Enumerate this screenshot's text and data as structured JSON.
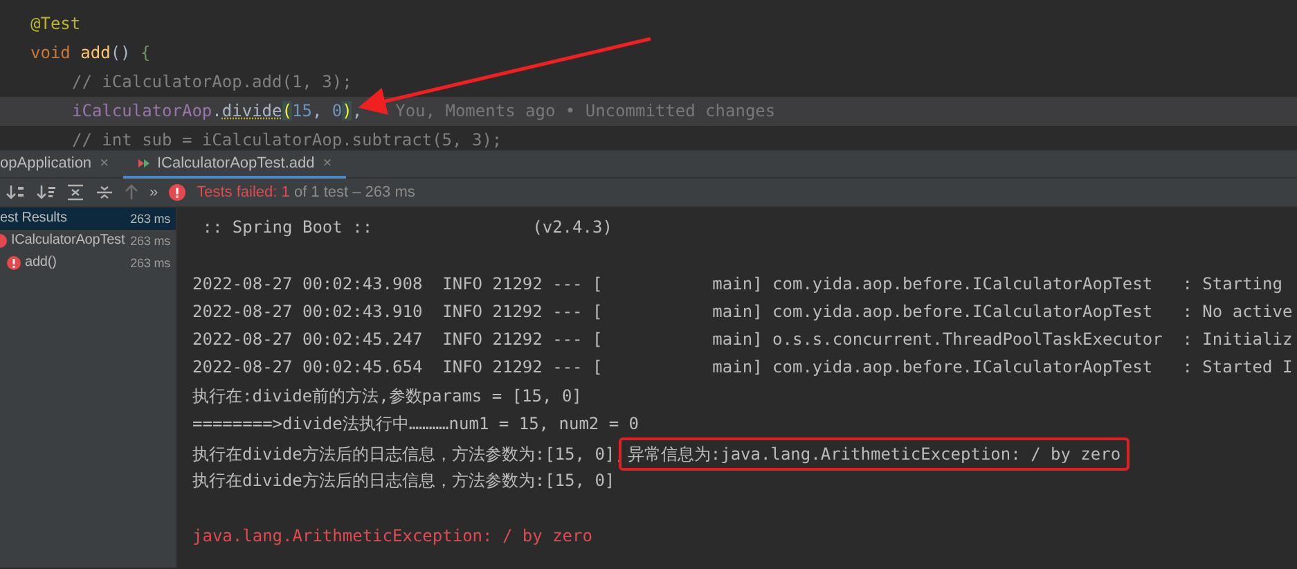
{
  "editor": {
    "lines": [
      {
        "indented": false,
        "current": false,
        "segments": [
          {
            "text": "@Test",
            "kind": "annotation"
          }
        ]
      },
      {
        "indented": false,
        "current": false,
        "segments": [
          {
            "text": "void ",
            "kind": "keyword"
          },
          {
            "text": "add",
            "kind": "method"
          },
          {
            "text": "() ",
            "kind": "plain"
          },
          {
            "text": "{",
            "kind": "brace"
          }
        ]
      },
      {
        "indented": true,
        "current": false,
        "segments": [
          {
            "text": "// iCalculatorAop.add(1, 3);",
            "kind": "comment"
          }
        ]
      },
      {
        "indented": true,
        "current": true,
        "segments": [
          {
            "text": "iCalculatorAop",
            "kind": "field"
          },
          {
            "text": ".",
            "kind": "plain"
          },
          {
            "text": "divide",
            "kind": "call"
          },
          {
            "text": "(",
            "kind": "matched"
          },
          {
            "text": "15",
            "kind": "number"
          },
          {
            "text": ", ",
            "kind": "plain"
          },
          {
            "text": "0",
            "kind": "number"
          },
          {
            "text": ")",
            "kind": "matched"
          },
          {
            "text": ",",
            "kind": "plain"
          },
          {
            "text": "You, Moments ago • Uncommitted changes",
            "kind": "hint"
          }
        ]
      },
      {
        "indented": true,
        "current": false,
        "segments": [
          {
            "text": "// int sub = iCalculatorAop.subtract(5, 3);",
            "kind": "comment"
          }
        ]
      }
    ]
  },
  "tabs": [
    {
      "label": "opApplication",
      "close": "×",
      "selected": false
    },
    {
      "label": "ICalculatorAopTest.add",
      "close": "×",
      "selected": true
    }
  ],
  "toolbar": {
    "more": "»",
    "failed": "Tests failed: 1",
    "summary": " of 1 test – 263 ms"
  },
  "tree": [
    {
      "label": "est Results",
      "time": "263 ms",
      "selected": true,
      "failed": false,
      "children": [
        {
          "label": "ICalculatorAopTest",
          "time": "263 ms",
          "selected": false,
          "failed": true,
          "children": [
            {
              "label": "add()",
              "time": "263 ms",
              "selected": false,
              "failed": true
            }
          ]
        }
      ]
    }
  ],
  "console": [
    {
      "kind": "plain",
      "segments": [
        {
          "text": " :: Spring Boot ::                (v2.4.3)",
          "boxed": false
        }
      ]
    },
    {
      "kind": "blank"
    },
    {
      "kind": "plain",
      "segments": [
        {
          "text": "2022-08-27 00:02:43.908  INFO 21292 --- [           main] com.yida.aop.before.ICalculatorAopTest   : Starting",
          "boxed": false
        }
      ]
    },
    {
      "kind": "plain",
      "segments": [
        {
          "text": "2022-08-27 00:02:43.910  INFO 21292 --- [           main] com.yida.aop.before.ICalculatorAopTest   : No active",
          "boxed": false
        }
      ]
    },
    {
      "kind": "plain",
      "segments": [
        {
          "text": "2022-08-27 00:02:45.247  INFO 21292 --- [           main] o.s.s.concurrent.ThreadPoolTaskExecutor  : Initializ",
          "boxed": false
        }
      ]
    },
    {
      "kind": "plain",
      "segments": [
        {
          "text": "2022-08-27 00:02:45.654  INFO 21292 --- [           main] com.yida.aop.before.ICalculatorAopTest   : Started I",
          "boxed": false
        }
      ]
    },
    {
      "kind": "plain",
      "segments": [
        {
          "text": "执行在:divide前的方法,参数params = [15, 0]",
          "boxed": false
        }
      ]
    },
    {
      "kind": "plain",
      "segments": [
        {
          "text": "========>divide法执行中…………num1 = 15, num2 = 0",
          "boxed": false
        }
      ]
    },
    {
      "kind": "plain",
      "segments": [
        {
          "text": "执行在divide方法后的日志信息，方法参数为:[15, 0],",
          "boxed": false
        },
        {
          "text": "异常信息为:java.lang.ArithmeticException: / by zero",
          "boxed": true
        }
      ]
    },
    {
      "kind": "plain",
      "segments": [
        {
          "text": "执行在divide方法后的日志信息，方法参数为:[15, 0]",
          "boxed": false
        }
      ]
    },
    {
      "kind": "blank"
    },
    {
      "kind": "error",
      "segments": [
        {
          "text": "java.lang.ArithmeticException: / by zero",
          "boxed": false
        }
      ]
    }
  ]
}
